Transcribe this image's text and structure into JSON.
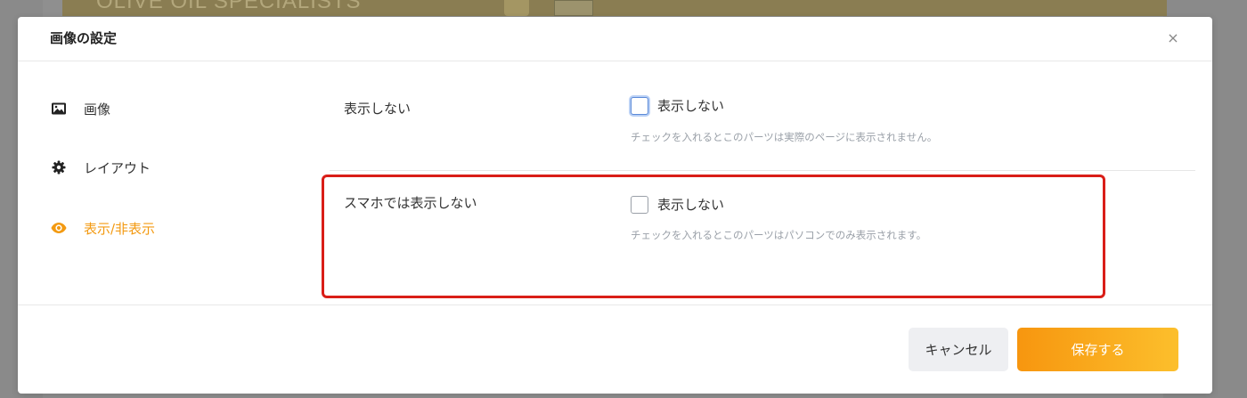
{
  "backdrop": {
    "banner_text": "OLIVE OIL SPECIALISTS"
  },
  "modal": {
    "title": "画像の設定",
    "close_symbol": "×"
  },
  "sidebar": {
    "items": [
      {
        "label": "画像",
        "icon": "image-icon",
        "active": false
      },
      {
        "label": "レイアウト",
        "icon": "gear-icon",
        "active": false
      },
      {
        "label": "表示/非表示",
        "icon": "eye-icon",
        "active": true
      }
    ]
  },
  "settings": {
    "rows": [
      {
        "label": "表示しない",
        "checkbox_label": "表示しない",
        "checked": false,
        "help": "チェックを入れるとこのパーツは実際のページに表示されません。"
      },
      {
        "label": "スマホでは表示しない",
        "checkbox_label": "表示しない",
        "checked": false,
        "help": "チェックを入れるとこのパーツはパソコンでのみ表示されます。"
      }
    ]
  },
  "footer": {
    "cancel_label": "キャンセル",
    "save_label": "保存する"
  },
  "colors": {
    "accent": "#f39a12",
    "save_gradient_start": "#f7960f",
    "save_gradient_end": "#fcbf2c",
    "highlight": "#d91e18"
  }
}
